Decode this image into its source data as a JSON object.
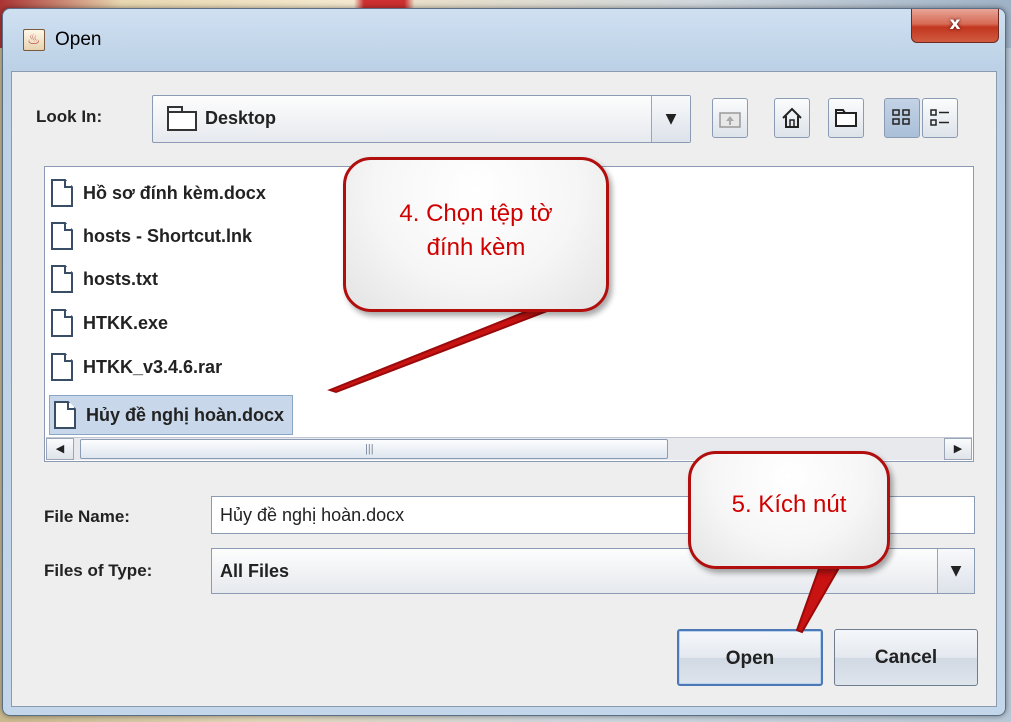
{
  "window": {
    "title": "Open",
    "close_label": "x"
  },
  "look_in": {
    "label": "Look In:",
    "value": "Desktop"
  },
  "toolbar": {
    "up_icon": "folder-up-icon",
    "home_icon": "home-icon",
    "new_folder_icon": "new-folder-icon",
    "list_view_icon": "list-view-icon",
    "details_view_icon": "details-view-icon"
  },
  "files": [
    {
      "name": "Hồ sơ đính kèm.docx"
    },
    {
      "name": "hosts - Shortcut.lnk"
    },
    {
      "name": "hosts.txt"
    },
    {
      "name": "HTKK.exe"
    },
    {
      "name": "HTKK_v3.4.6.rar"
    },
    {
      "name": "Hủy đề nghị hoàn.docx",
      "selected": true
    }
  ],
  "file_name": {
    "label": "File Name:",
    "value": "Hủy đề nghị hoàn.docx"
  },
  "file_type": {
    "label": "Files of Type:",
    "value": "All Files"
  },
  "buttons": {
    "open": "Open",
    "cancel": "Cancel"
  },
  "callouts": {
    "step4_line1": "4. Chọn tệp tờ",
    "step4_line2": "đính kèm",
    "step5": "5. Kích nút"
  },
  "colors": {
    "callout_border": "#b10e0e",
    "callout_text": "#d10000",
    "selection": "#c8d8ea"
  }
}
